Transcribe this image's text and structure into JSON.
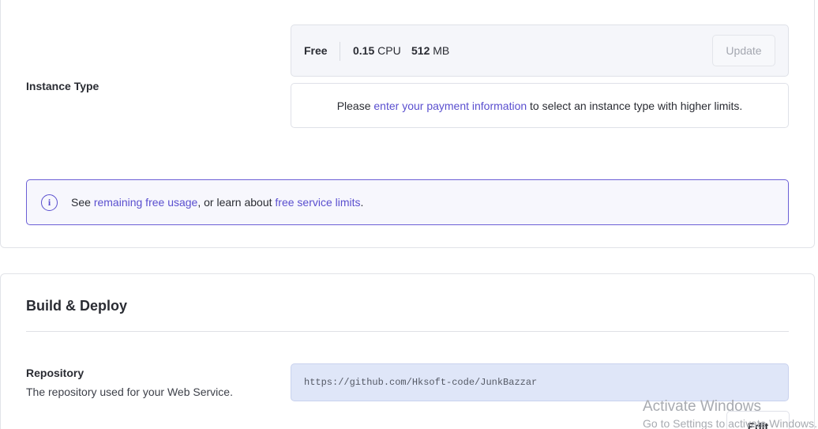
{
  "instance": {
    "label": "Instance Type",
    "plan": "Free",
    "cpu_value": "0.15",
    "cpu_unit": "CPU",
    "mem_value": "512",
    "mem_unit": "MB",
    "update_label": "Update",
    "payment_prefix": "Please",
    "payment_link": "enter your payment information",
    "payment_suffix": "to select an instance type with higher limits."
  },
  "info": {
    "icon": "info-icon",
    "prefix": "See",
    "usage_link": "remaining free usage",
    "middle": ", or learn about",
    "limits_link": "free service limits",
    "suffix": "."
  },
  "build": {
    "title": "Build & Deploy",
    "repo_label": "Repository",
    "repo_desc": "The repository used for your Web Service.",
    "repo_url": "https://github.com/Hksoft-code/JunkBazzar",
    "edit_label": "Edit"
  },
  "watermark": {
    "title": "Activate Windows",
    "subtitle": "Go to Settings to activate Windows."
  },
  "colors": {
    "accent": "#5a4fcf",
    "repo_bg": "#dfe6f8"
  }
}
